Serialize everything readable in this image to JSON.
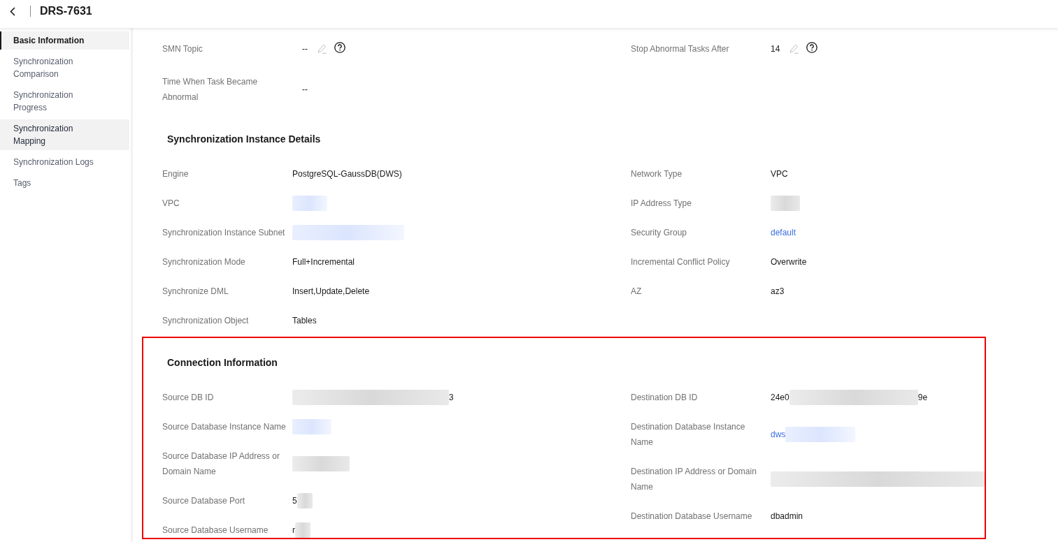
{
  "header": {
    "title": "DRS-7631"
  },
  "sidebar": {
    "items": [
      {
        "label": "Basic Information",
        "selected": true,
        "hovered": false
      },
      {
        "label": "Synchronization Comparison",
        "selected": false,
        "hovered": false
      },
      {
        "label": "Synchronization Progress",
        "selected": false,
        "hovered": false
      },
      {
        "label": "Synchronization Mapping",
        "selected": false,
        "hovered": true
      },
      {
        "label": "Synchronization Logs",
        "selected": false,
        "hovered": false
      },
      {
        "label": "Tags",
        "selected": false,
        "hovered": false
      }
    ]
  },
  "sections": [
    {
      "highlighted": false,
      "left": [
        {
          "label": "SMN Topic",
          "value": [
            {
              "kind": "text",
              "text": "--"
            },
            {
              "kind": "edit"
            },
            {
              "kind": "help"
            }
          ]
        },
        {
          "label": "Time When Task Became Abnormal",
          "value": [
            {
              "kind": "text",
              "text": "--"
            }
          ]
        }
      ],
      "right": [
        {
          "label": "Stop Abnormal Tasks After",
          "value": [
            {
              "kind": "text",
              "text": "14"
            },
            {
              "kind": "edit"
            },
            {
              "kind": "help"
            }
          ]
        }
      ]
    },
    {
      "title": "Synchronization Instance Details",
      "highlighted": false,
      "left": [
        {
          "label": "Engine",
          "value": [
            {
              "kind": "text",
              "text": "PostgreSQL-GaussDB(DWS)"
            }
          ]
        },
        {
          "label": "VPC",
          "value": [
            {
              "kind": "link-blur"
            }
          ]
        },
        {
          "label": "Synchronization Instance Subnet",
          "value": [
            {
              "kind": "link-blur"
            }
          ]
        },
        {
          "label": "Synchronization Mode",
          "value": [
            {
              "kind": "text",
              "text": "Full+Incremental"
            }
          ]
        },
        {
          "label": "Synchronize DML",
          "value": [
            {
              "kind": "text",
              "text": "Insert,Update,Delete"
            }
          ]
        },
        {
          "label": "Synchronization Object",
          "value": [
            {
              "kind": "text",
              "text": "Tables"
            }
          ]
        }
      ],
      "right": [
        {
          "label": "Network Type",
          "value": [
            {
              "kind": "text",
              "text": "VPC"
            }
          ]
        },
        {
          "label": "IP Address Type",
          "value": [
            {
              "kind": "blur"
            }
          ]
        },
        {
          "label": "Security Group",
          "value": [
            {
              "kind": "link",
              "text": "default"
            }
          ]
        },
        {
          "label": "Incremental Conflict Policy",
          "value": [
            {
              "kind": "text",
              "text": "Overwrite"
            }
          ]
        },
        {
          "label": "AZ",
          "value": [
            {
              "kind": "text",
              "text": "az3"
            }
          ]
        }
      ]
    },
    {
      "title": "Connection Information",
      "highlighted": true,
      "left": [
        {
          "label": "Source DB ID",
          "value": [
            {
              "kind": "blur"
            },
            {
              "kind": "text",
              "text": "3"
            }
          ]
        },
        {
          "label": "Source Database Instance Name",
          "value": [
            {
              "kind": "link-blur"
            }
          ]
        },
        {
          "label": "Source Database IP Address or Domain Name",
          "value": [
            {
              "kind": "blur"
            }
          ]
        },
        {
          "label": "Source Database Port",
          "value": [
            {
              "kind": "text",
              "text": "5"
            },
            {
              "kind": "blur"
            }
          ]
        },
        {
          "label": "Source Database Username",
          "value": [
            {
              "kind": "text",
              "text": "r"
            },
            {
              "kind": "blur"
            }
          ]
        }
      ],
      "right": [
        {
          "label": "Destination DB ID",
          "value": [
            {
              "kind": "text",
              "text": "24e0"
            },
            {
              "kind": "blur"
            },
            {
              "kind": "text",
              "text": "9e"
            }
          ]
        },
        {
          "label": "Destination Database Instance Name",
          "value": [
            {
              "kind": "link",
              "text": "dws"
            },
            {
              "kind": "link-blur"
            }
          ]
        },
        {
          "label": "Destination IP Address or Domain Name",
          "value": [
            {
              "kind": "blur"
            }
          ]
        },
        {
          "label": "Destination Database Username",
          "value": [
            {
              "kind": "text",
              "text": "dbadmin"
            }
          ]
        }
      ]
    }
  ]
}
